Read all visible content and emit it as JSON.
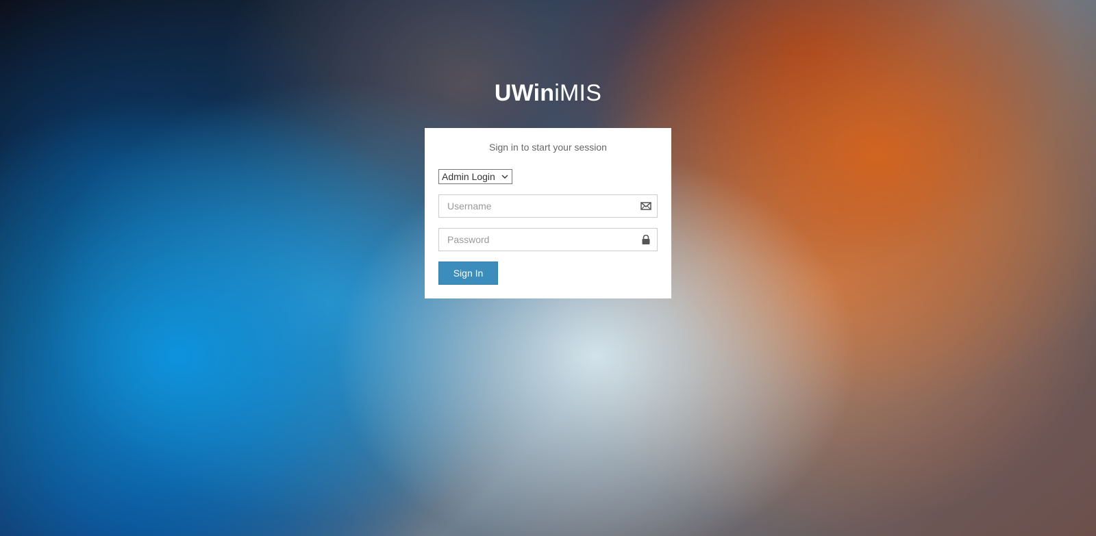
{
  "logo": {
    "bold_part": "UWin",
    "light_part": "iMIS"
  },
  "login_box": {
    "message": "Sign in to start your session",
    "login_type": {
      "selected": "Admin Login",
      "icon": "chevron-down-icon"
    },
    "username": {
      "placeholder": "Username",
      "value": "",
      "icon": "envelope-icon"
    },
    "password": {
      "placeholder": "Password",
      "value": "",
      "icon": "lock-icon"
    },
    "submit_label": "Sign In"
  },
  "colors": {
    "primary_button": "#3c8dbc",
    "box_background": "#ffffff",
    "message_text": "#666666"
  }
}
